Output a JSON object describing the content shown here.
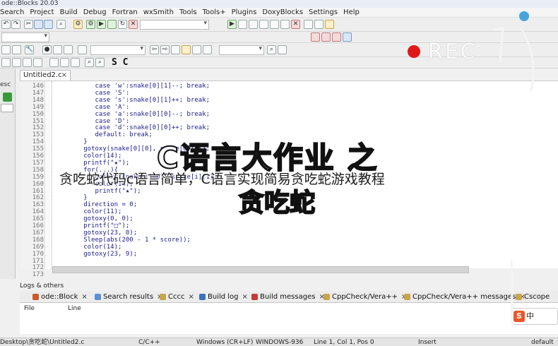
{
  "window": {
    "title": "ode::Blocks 20.03"
  },
  "menu": [
    "Search",
    "Project",
    "Build",
    "Debug",
    "Fortran",
    "wxSmith",
    "Tools",
    "Tools+",
    "Plugins",
    "DoxyBlocks",
    "Settings",
    "Help"
  ],
  "toolbar": {
    "scope_label": "S C"
  },
  "left_panel": {
    "label": "esc"
  },
  "editor": {
    "tab_label": "Untitled2.c",
    "tab_close": "×",
    "line_numbers": [
      "146",
      "147",
      "148",
      "149",
      "150",
      "151",
      "152",
      "153",
      "154",
      "155",
      "156",
      "157",
      "158",
      "159",
      "160",
      "161",
      "162",
      "163",
      "164",
      "165",
      "166",
      "167",
      "168",
      "169",
      "170",
      "171",
      "172",
      "173"
    ],
    "lines": [
      "      case 'w':snake[0][1]--; break;",
      "      case 'S':",
      "      case 's':snake[0][1]++; break;",
      "      case 'A':",
      "      case 'a':snake[0][0]--; break;",
      "      case 'D':",
      "      case 'd':snake[0][0]++; break;",
      "      default: break;",
      "   }",
      "   gotoxy(snake[0][0], snake[0][1]);",
      "   color(14);",
      "   printf(\"★\");",
      "   for(...){",
      "      gotoxy(snake[i][0], snake[i][1]);",
      "      color(14);",
      "      printf(\"★\");",
      "   }",
      "   direction = 0;",
      "   color(11);",
      "   gotoxy(0, 0);",
      "   printf(\"□\");",
      "   gotoxy(23, 0);",
      "   Sleep(abs(200 - 1 * score));",
      "   color(14);",
      "   gotoxy(23, 9);"
    ]
  },
  "logs": {
    "label": "Logs & others",
    "tabs": [
      "ode::Block",
      "Search results",
      "Cccc",
      "Build log",
      "Build messages",
      "CppCheck/Vera++",
      "CppCheck/Vera++ messages",
      "Cscope"
    ],
    "columns": [
      "File",
      "Line"
    ]
  },
  "status": {
    "path": "Desktop\\贪吃蛇\\Untitled2.c",
    "lang": "C/C++",
    "eol": "Windows (CR+LF)",
    "encoding": "WINDOWS-936",
    "position": "Line 1, Col 1, Pos 0",
    "mode": "Insert",
    "profile": "default"
  },
  "overlay": {
    "rec": "REC",
    "big_title": "C语言大作业 之",
    "big_title_2": "贪吃蛇",
    "caption": "贪吃蛇代码c语言简单，C语言实现简易贪吃蛇游戏教程"
  },
  "ime": {
    "label": "中",
    "icon": "S"
  },
  "colors": {
    "rec_dot": "#e01818",
    "ime_icon": "#e9572b",
    "keyword": "#00008b"
  }
}
